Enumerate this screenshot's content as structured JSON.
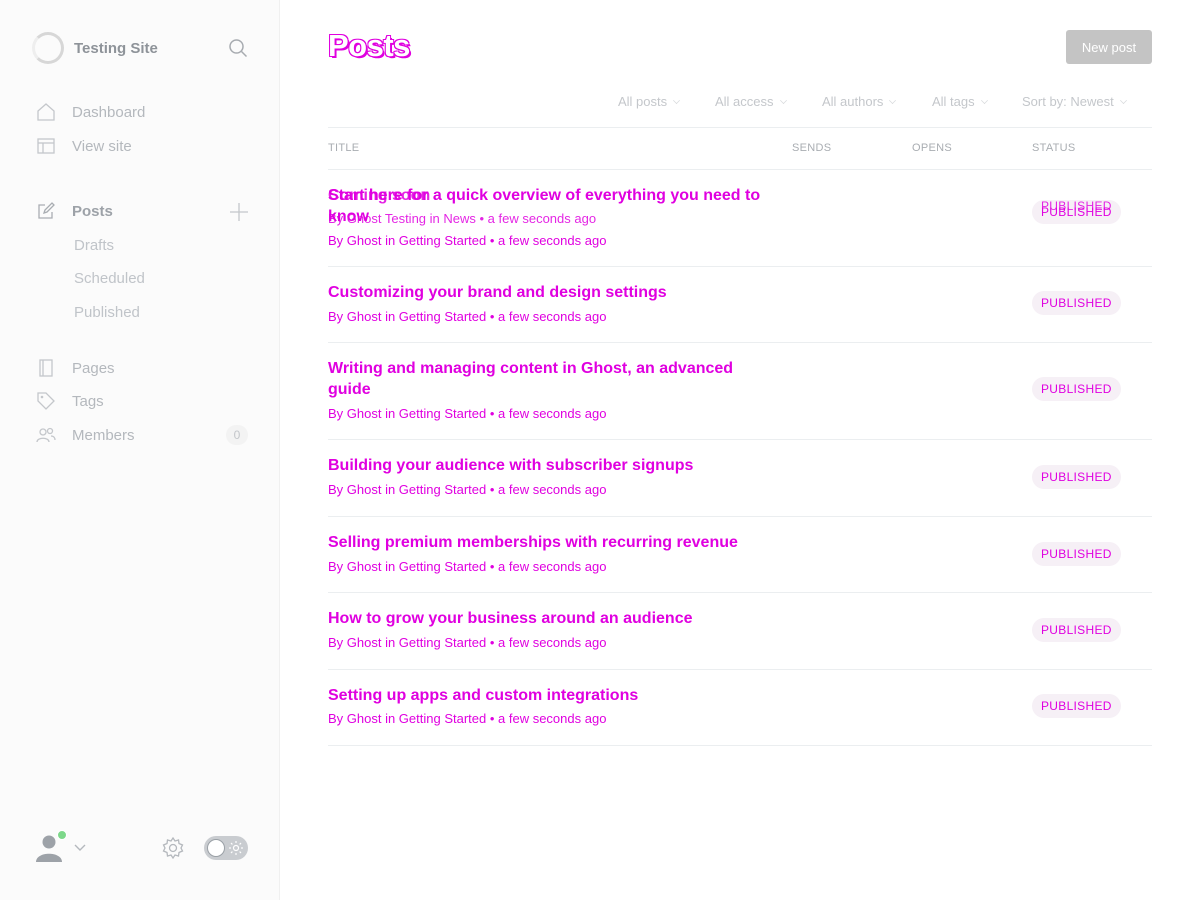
{
  "sidebar": {
    "site_name": "Testing Site",
    "nav": {
      "dashboard": "Dashboard",
      "view_site": "View site",
      "posts": "Posts",
      "drafts": "Drafts",
      "scheduled": "Scheduled",
      "published": "Published",
      "pages": "Pages",
      "tags": "Tags",
      "members": "Members",
      "members_count": "0"
    }
  },
  "main": {
    "title": "Posts",
    "new_post_label": "New post",
    "filters": {
      "posts": "All posts",
      "access": "All access",
      "authors": "All authors",
      "tags": "All tags",
      "sort": "Sort by: Newest"
    },
    "columns": {
      "title": "TITLE",
      "sends": "SENDS",
      "opens": "OPENS",
      "status": "STATUS"
    },
    "overlay": {
      "title": "Coming soon",
      "meta": "By Ghost Testing in News • a few seconds ago",
      "status": "PUBLISHED"
    },
    "posts": [
      {
        "title": "Start here for a quick overview of everything you need to know",
        "meta": "By Ghost in Getting Started • a few seconds ago",
        "status": "PUBLISHED"
      },
      {
        "title": "Customizing your brand and design settings",
        "meta": "By Ghost in Getting Started • a few seconds ago",
        "status": "PUBLISHED"
      },
      {
        "title": "Writing and managing content in Ghost, an advanced guide",
        "meta": "By Ghost in Getting Started • a few seconds ago",
        "status": "PUBLISHED"
      },
      {
        "title": "Building your audience with subscriber signups",
        "meta": "By Ghost in Getting Started • a few seconds ago",
        "status": "PUBLISHED"
      },
      {
        "title": "Selling premium memberships with recurring revenue",
        "meta": "By Ghost in Getting Started • a few seconds ago",
        "status": "PUBLISHED"
      },
      {
        "title": "How to grow your business around an audience",
        "meta": "By Ghost in Getting Started • a few seconds ago",
        "status": "PUBLISHED"
      },
      {
        "title": "Setting up apps and custom integrations",
        "meta": "By Ghost in Getting Started • a few seconds ago",
        "status": "PUBLISHED"
      }
    ]
  },
  "colors": {
    "accent": "#e000e0",
    "sidebar_bg": "#fbfbfb",
    "online": "#7dd88a"
  }
}
